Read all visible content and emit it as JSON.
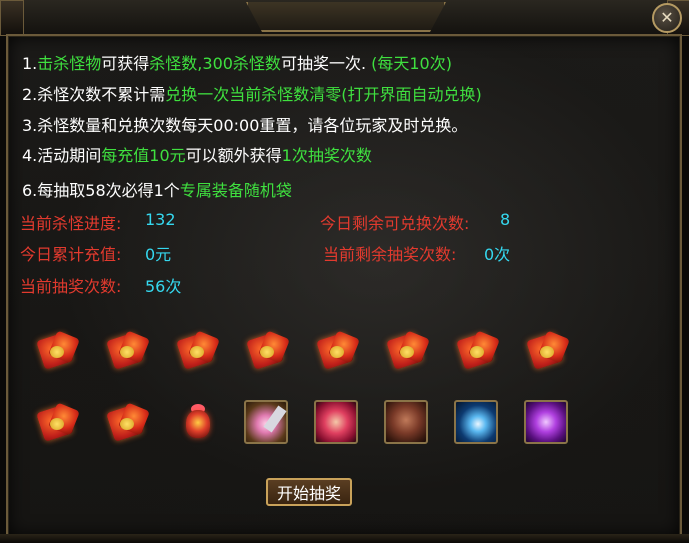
{
  "window": {
    "close_glyph": "✕"
  },
  "rules": {
    "line1": {
      "a": "1.",
      "b": "击杀怪物",
      "c": "可获得",
      "d": "杀怪数,300杀怪数",
      "e": "可抽奖一次.",
      "f": "(每天10次)"
    },
    "line2": {
      "a": "2.杀怪次数不累计需",
      "b": "兑换一次当前杀怪数清零(打开界面自动兑换)"
    },
    "line3": {
      "a": "3.杀怪数量和兑换次数每天00:00重置，请各位玩家及时兑换。"
    },
    "line4": {
      "a": "4.活动期间",
      "b": "每充值10元",
      "c": "可以额外获得",
      "d": "1次抽奖次数"
    },
    "line6": {
      "a": "6.每抽取58次必得1个",
      "b": "专属装备随机袋"
    }
  },
  "stats": {
    "kill_progress_label": "当前杀怪进度:",
    "kill_progress_value": "132",
    "remaining_exchange_label": "今日剩余可兑换次数:",
    "remaining_exchange_value": "8",
    "recharge_label": "今日累计充值:",
    "recharge_value": "0元",
    "remaining_draw_label": "当前剩余抽奖次数:",
    "remaining_draw_value": "0次",
    "draw_count_label": "当前抽奖次数:",
    "draw_count_value": "56次"
  },
  "rewards": {
    "row1": [
      "red-pouch-icon",
      "red-pouch-icon",
      "red-pouch-icon",
      "red-pouch-icon",
      "red-pouch-icon",
      "red-pouch-icon",
      "red-pouch-icon",
      "red-pouch-icon"
    ],
    "row2": [
      "red-pouch-icon",
      "red-pouch-icon",
      "treasure-bag-icon",
      "flower-blade-skill-icon",
      "fist-skill-icon",
      "warrior-face-icon",
      "moon-skill-icon",
      "purple-skill-icon"
    ]
  },
  "actions": {
    "start_draw_label": "开始抽奖"
  },
  "colors": {
    "highlight_green": "#3fe03f",
    "label_red": "#e23a2e",
    "value_cyan": "#35d8ef",
    "frame_gold": "#8a7448"
  }
}
